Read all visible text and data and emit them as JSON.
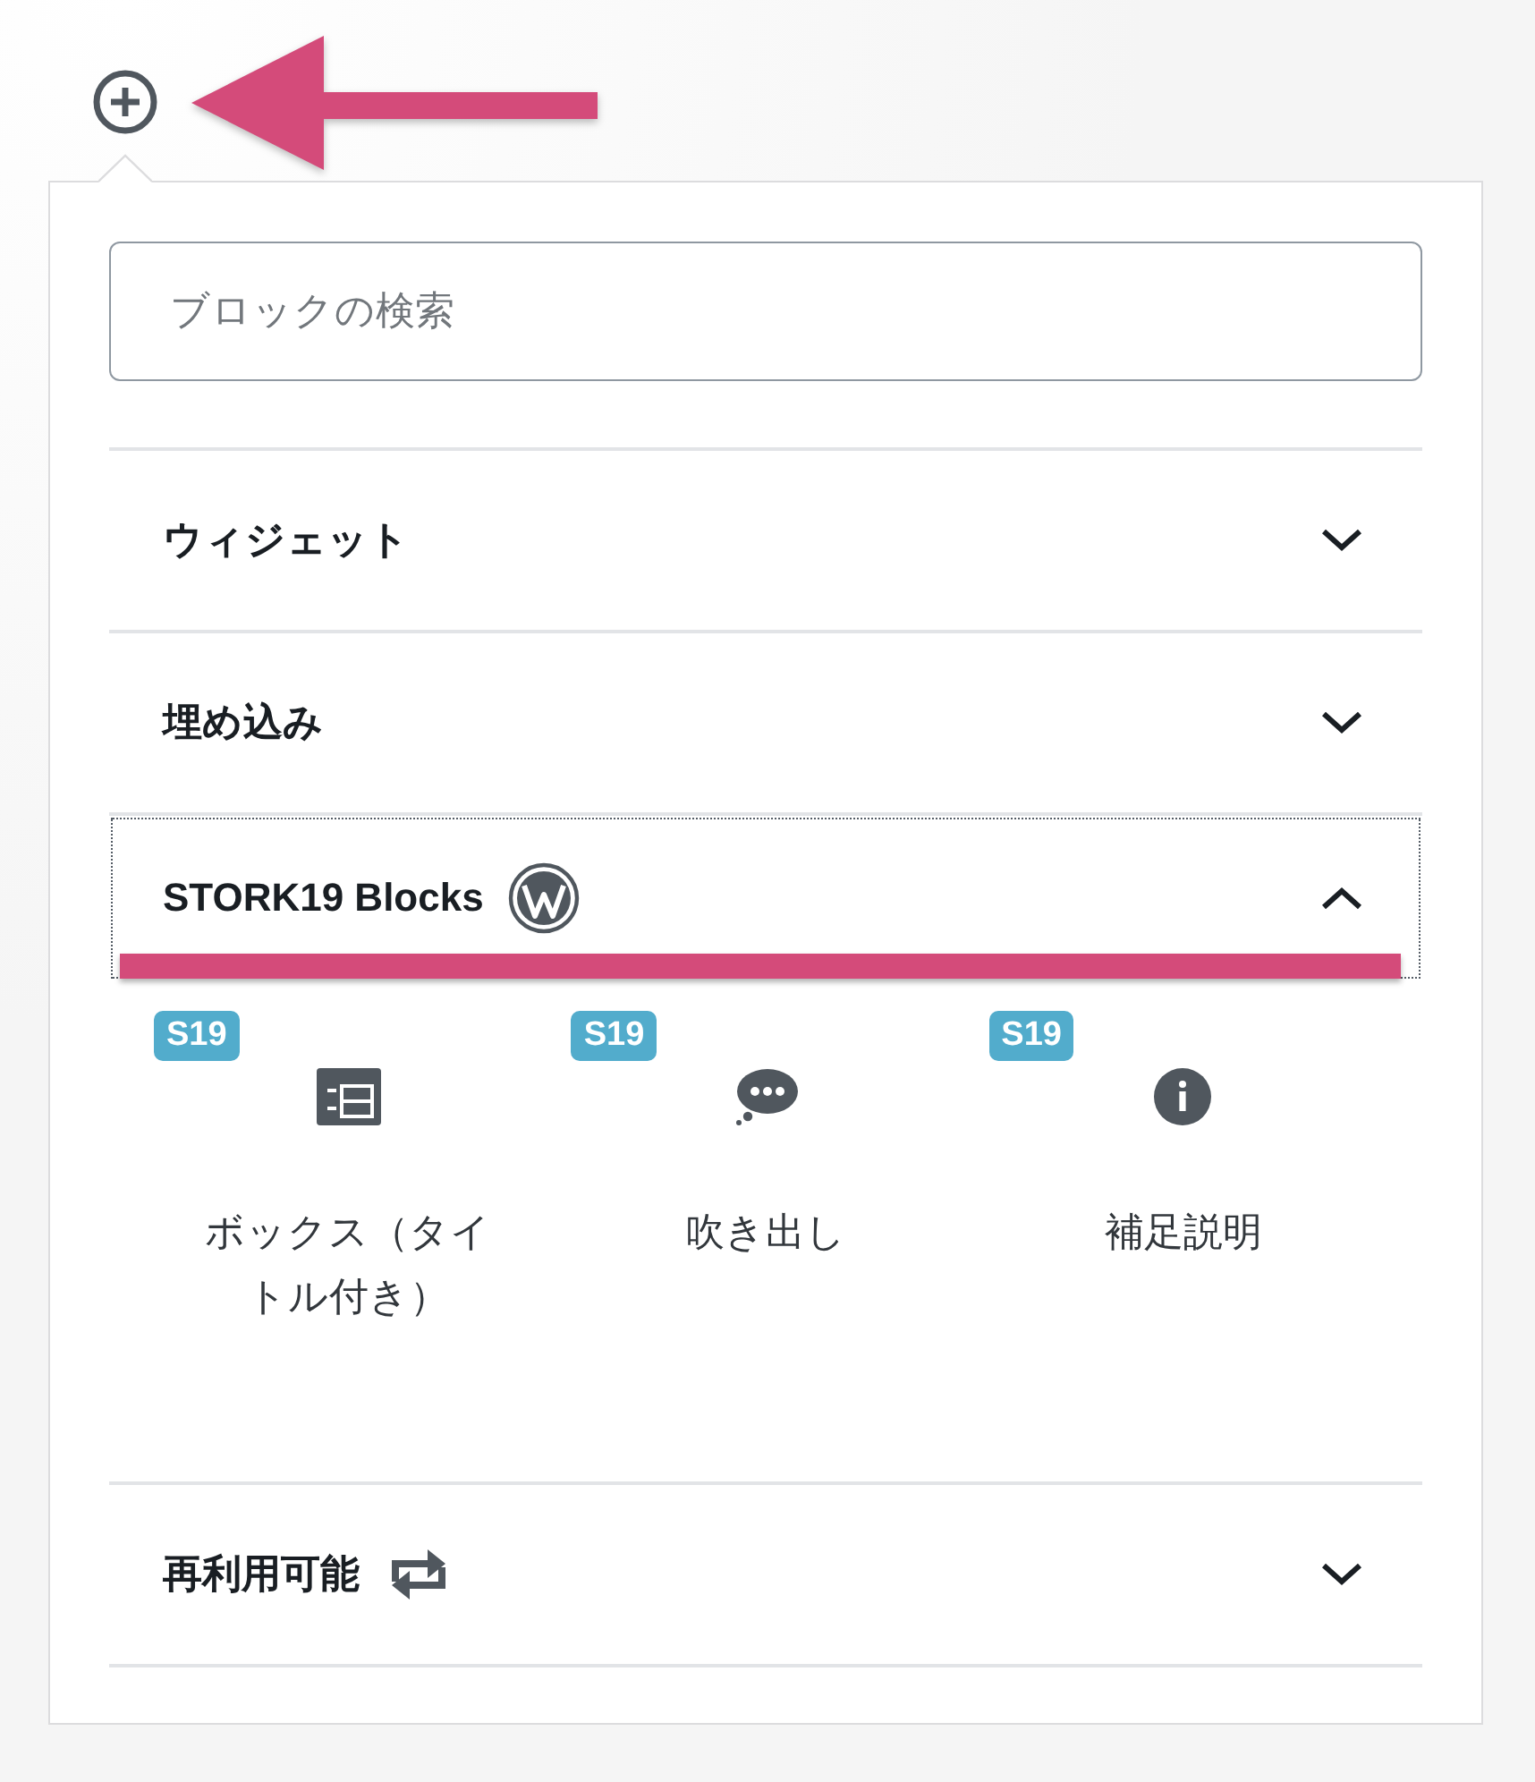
{
  "search": {
    "placeholder": "ブロックの検索"
  },
  "categories": [
    {
      "title": "ウィジェット",
      "kind": "plain",
      "expanded": false,
      "focused": false
    },
    {
      "title": "埋め込み",
      "kind": "plain",
      "expanded": false,
      "focused": false
    },
    {
      "title": "STORK19 Blocks",
      "kind": "logo",
      "expanded": true,
      "focused": true,
      "blocks": [
        {
          "badge": "S19",
          "label": "ボックス（タイトル付き）",
          "kind": "box"
        },
        {
          "badge": "S19",
          "label": "吹き出し",
          "kind": "balloon"
        },
        {
          "badge": "S19",
          "label": "補足説明",
          "kind": "info"
        }
      ]
    },
    {
      "title": "再利用可能",
      "kind": "reusable",
      "expanded": false,
      "focused": false
    }
  ]
}
